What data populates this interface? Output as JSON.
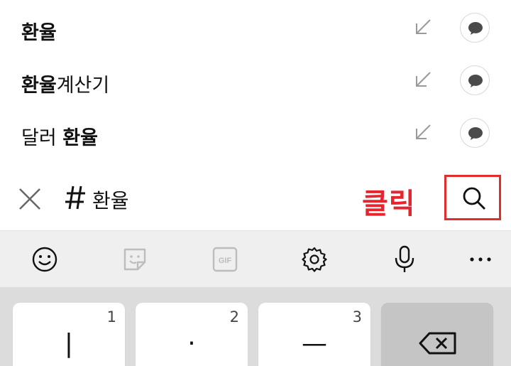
{
  "suggestions": [
    {
      "parts": [
        {
          "text": "환율",
          "bold": true
        }
      ]
    },
    {
      "parts": [
        {
          "text": "환율",
          "bold": true
        },
        {
          "text": "계산기",
          "bold": false
        }
      ]
    },
    {
      "parts": [
        {
          "text": "달러 ",
          "bold": false
        },
        {
          "text": "환율",
          "bold": true
        }
      ]
    }
  ],
  "search": {
    "hash": "#",
    "query": "환율",
    "callout": "클릭"
  },
  "toolbar": {
    "items": [
      "emoji-icon",
      "sticker-icon",
      "gif-icon",
      "settings-icon",
      "microphone-icon",
      "more-icon"
    ],
    "gif_label": "GIF",
    "more_label": "•••"
  },
  "keyboard": {
    "keys": [
      {
        "num": "1",
        "glyph": "|"
      },
      {
        "num": "2",
        "glyph": "·"
      },
      {
        "num": "3",
        "glyph": "—"
      }
    ]
  },
  "colors": {
    "accent_red": "#e02d2d",
    "toolbar_bg": "#efefef",
    "keyboard_bg": "#dcdcdc",
    "backspace_key_bg": "#c5c5c5"
  }
}
